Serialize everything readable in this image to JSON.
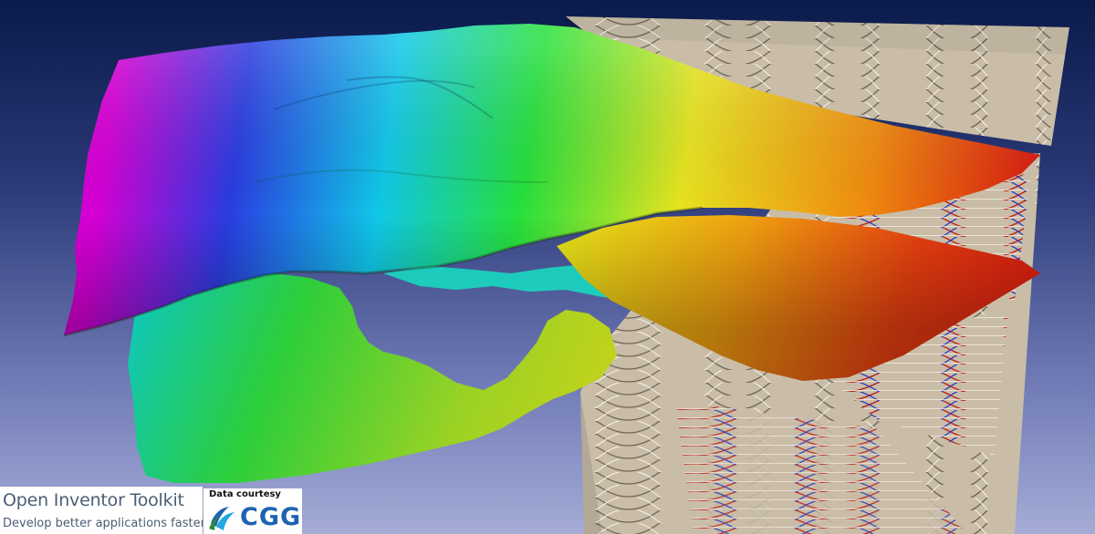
{
  "branding": {
    "product_title": "Open Inventor Toolkit",
    "tagline": "Develop better applications faster"
  },
  "credit": {
    "courtesy": "Data courtesy",
    "logo_text": "CGG"
  },
  "colors": {
    "background_top": "#0a1a4a",
    "background_bottom": "#a4acd6",
    "horizon_magenta": "#d400d4",
    "horizon_blue": "#2a3ce0",
    "horizon_cyan": "#10c8e8",
    "horizon_green": "#26e03c",
    "horizon_yellow": "#e8e420",
    "horizon_orange": "#f08a10",
    "horizon_red": "#d81810",
    "seismic_base": "#c9bda8",
    "logo_blue": "#1e63b0"
  }
}
